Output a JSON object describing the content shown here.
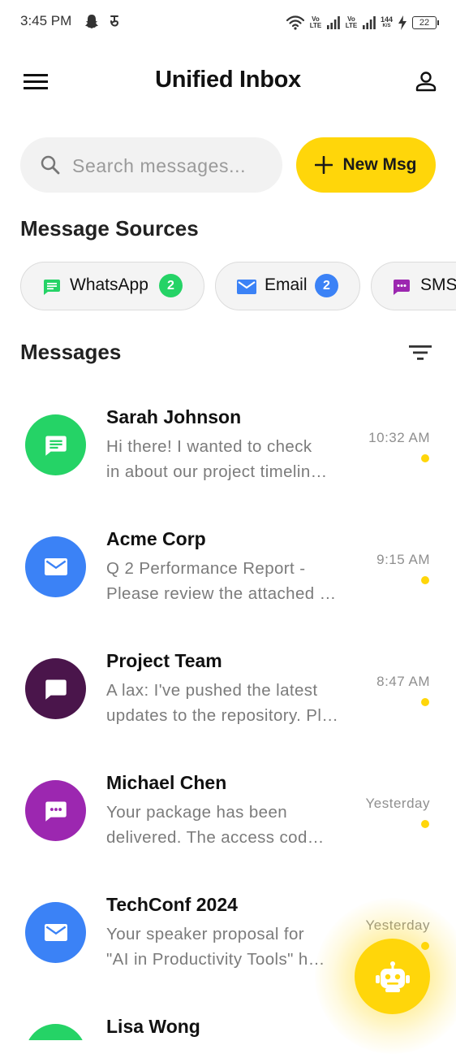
{
  "status_bar": {
    "time": "3:45 PM",
    "network_speed_top": "144",
    "network_speed_bottom": "K/S",
    "battery": "22",
    "sim1": "Vo LTE",
    "sim2": "Vo LTE"
  },
  "header": {
    "title": "Unified Inbox",
    "menu_icon": "menu-icon",
    "profile_icon": "person-icon"
  },
  "search": {
    "placeholder": "Search messages...",
    "value": ""
  },
  "new_button": {
    "label": "New Msg",
    "icon": "plus-icon"
  },
  "sources": {
    "title": "Message Sources",
    "chips": [
      {
        "label": "WhatsApp",
        "count": "2",
        "icon": "chat-icon",
        "color": "#25D366"
      },
      {
        "label": "Email",
        "count": "2",
        "icon": "mail-icon",
        "color": "#3B82F6"
      },
      {
        "label": "SMS",
        "icon": "sms-icon",
        "color": "#9C27B0"
      }
    ]
  },
  "messages_section": {
    "title": "Messages",
    "filter_icon": "filter-icon"
  },
  "messages": [
    {
      "name": "Sarah Johnson",
      "preview_line1": "Hi there! I wanted to check",
      "preview_line2": "in about our project timelin…",
      "time": "10:32 AM",
      "unread": true,
      "icon": "chat-icon",
      "avatar_color": "#25D366"
    },
    {
      "name": "Acme Corp",
      "preview_line1": "Q 2 Performance Report -",
      "preview_line2": "Please review the attached …",
      "time": "9:15 AM",
      "unread": true,
      "icon": "mail-icon",
      "avatar_color": "#3B82F6"
    },
    {
      "name": "Project Team",
      "preview_line1": "A lax: I've pushed the latest",
      "preview_line2": "updates to the repository. Pl…",
      "time": "8:47 AM",
      "unread": true,
      "icon": "message-icon",
      "avatar_color": "#4A154B"
    },
    {
      "name": "Michael Chen",
      "preview_line1": "Your package has been",
      "preview_line2": "delivered. The access cod…",
      "time": "Yesterday",
      "unread": true,
      "icon": "sms-icon",
      "avatar_color": "#9C27B0"
    },
    {
      "name": "TechConf 2024",
      "preview_line1": "Your speaker proposal for",
      "preview_line2": "\"AI in Productivity Tools\" h…",
      "time": "Yesterday",
      "unread": true,
      "icon": "mail-icon",
      "avatar_color": "#3B82F6"
    },
    {
      "name": "Lisa Wong",
      "preview_line1": "",
      "preview_line2": "",
      "time": "",
      "unread": false,
      "icon": "chat-icon",
      "avatar_color": "#25D366"
    }
  ],
  "fab": {
    "icon": "robot-icon"
  },
  "colors": {
    "accent": "#FFD60A",
    "whatsapp": "#25D366",
    "email": "#3B82F6",
    "sms": "#9C27B0",
    "slack": "#4A154B"
  }
}
